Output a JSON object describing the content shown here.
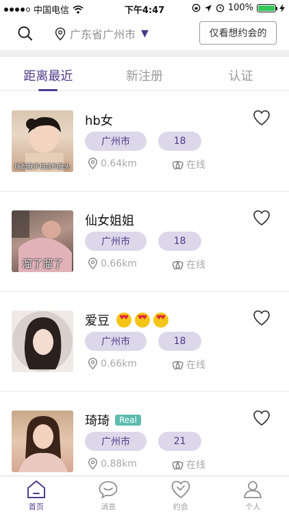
{
  "status_bar": {
    "carrier": "中国电信",
    "time": "下午4:47",
    "battery": "100%"
  },
  "header": {
    "location": "广东省广州市",
    "filter_button": "仅看想约会的"
  },
  "tabs": [
    {
      "label": "距离最近",
      "active": true
    },
    {
      "label": "新注册",
      "active": false
    },
    {
      "label": "认证",
      "active": false
    }
  ],
  "users": [
    {
      "name": "hb女",
      "city": "广州市",
      "age": "18",
      "distance": "0.64km",
      "status": "在线",
      "avatar_caption": "嗨起我手机就约我头",
      "emoji_count": 0,
      "real": false
    },
    {
      "name": "仙女姐姐",
      "city": "广州市",
      "age": "18",
      "distance": "0.66km",
      "status": "在线",
      "avatar_caption": "溜了溜了",
      "emoji_count": 0,
      "real": false
    },
    {
      "name": "爱豆",
      "city": "广州市",
      "age": "18",
      "distance": "0.66km",
      "status": "在线",
      "avatar_caption": "",
      "emoji_count": 3,
      "real": false
    },
    {
      "name": "琦琦",
      "city": "广州市",
      "age": "21",
      "distance": "0.88km",
      "status": "在线",
      "avatar_caption": "",
      "emoji_count": 0,
      "real": true,
      "real_label": "Real"
    }
  ],
  "tabbar": [
    {
      "label": "首页",
      "icon": "home-icon",
      "active": true
    },
    {
      "label": "消息",
      "icon": "message-icon",
      "active": false
    },
    {
      "label": "约会",
      "icon": "date-heart-icon",
      "active": false
    },
    {
      "label": "个人",
      "icon": "profile-icon",
      "active": false
    }
  ],
  "colors": {
    "accent": "#4b3a8a",
    "pill_bg": "#dcd8ea",
    "real_tag": "#5cbcad",
    "battery": "#34c759"
  }
}
